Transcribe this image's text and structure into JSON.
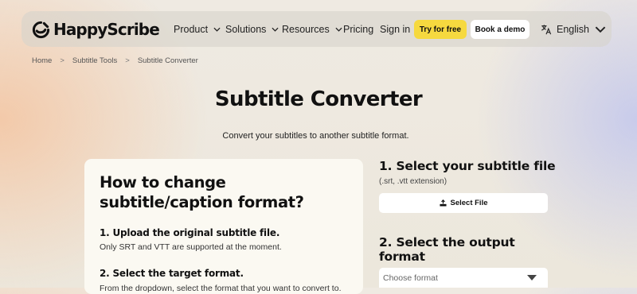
{
  "brand": {
    "name": "HappyScribe"
  },
  "nav": {
    "product": "Product",
    "solutions": "Solutions",
    "resources": "Resources",
    "pricing": "Pricing",
    "sign_in": "Sign in",
    "try_free": "Try for free",
    "book_demo": "Book a demo",
    "language": "English"
  },
  "breadcrumb": [
    "Home",
    "Subtitle Tools",
    "Subtitle Converter"
  ],
  "breadcrumb_separator": ">",
  "page": {
    "title": "Subtitle Converter",
    "subtitle": "Convert your subtitles to another subtitle format."
  },
  "howto": {
    "heading": "How to change subtitle/caption format?",
    "step1_title": "1. Upload the original subtitle file.",
    "step1_text": "Only SRT and VTT are supported at the moment.",
    "step2_title": "2. Select the target format.",
    "step2_text": "From the dropdown, select the format that you want to convert to."
  },
  "converter": {
    "step1_title": "1.  Select your subtitle file",
    "step1_hint": "(.srt, .vtt extension)",
    "select_file_label": "Select File",
    "step2_title": "2.  Select the output format",
    "format_placeholder": "Choose format"
  },
  "colors": {
    "accent_yellow": "#f6d93f",
    "nav_background": "#d6d4cc",
    "card_background": "#fbf9f2"
  },
  "icons": {
    "logo": "happyscribe-logo-icon",
    "chevron": "chevron-down-icon",
    "language": "translate-icon",
    "upload": "upload-icon",
    "caret": "caret-down-icon"
  }
}
